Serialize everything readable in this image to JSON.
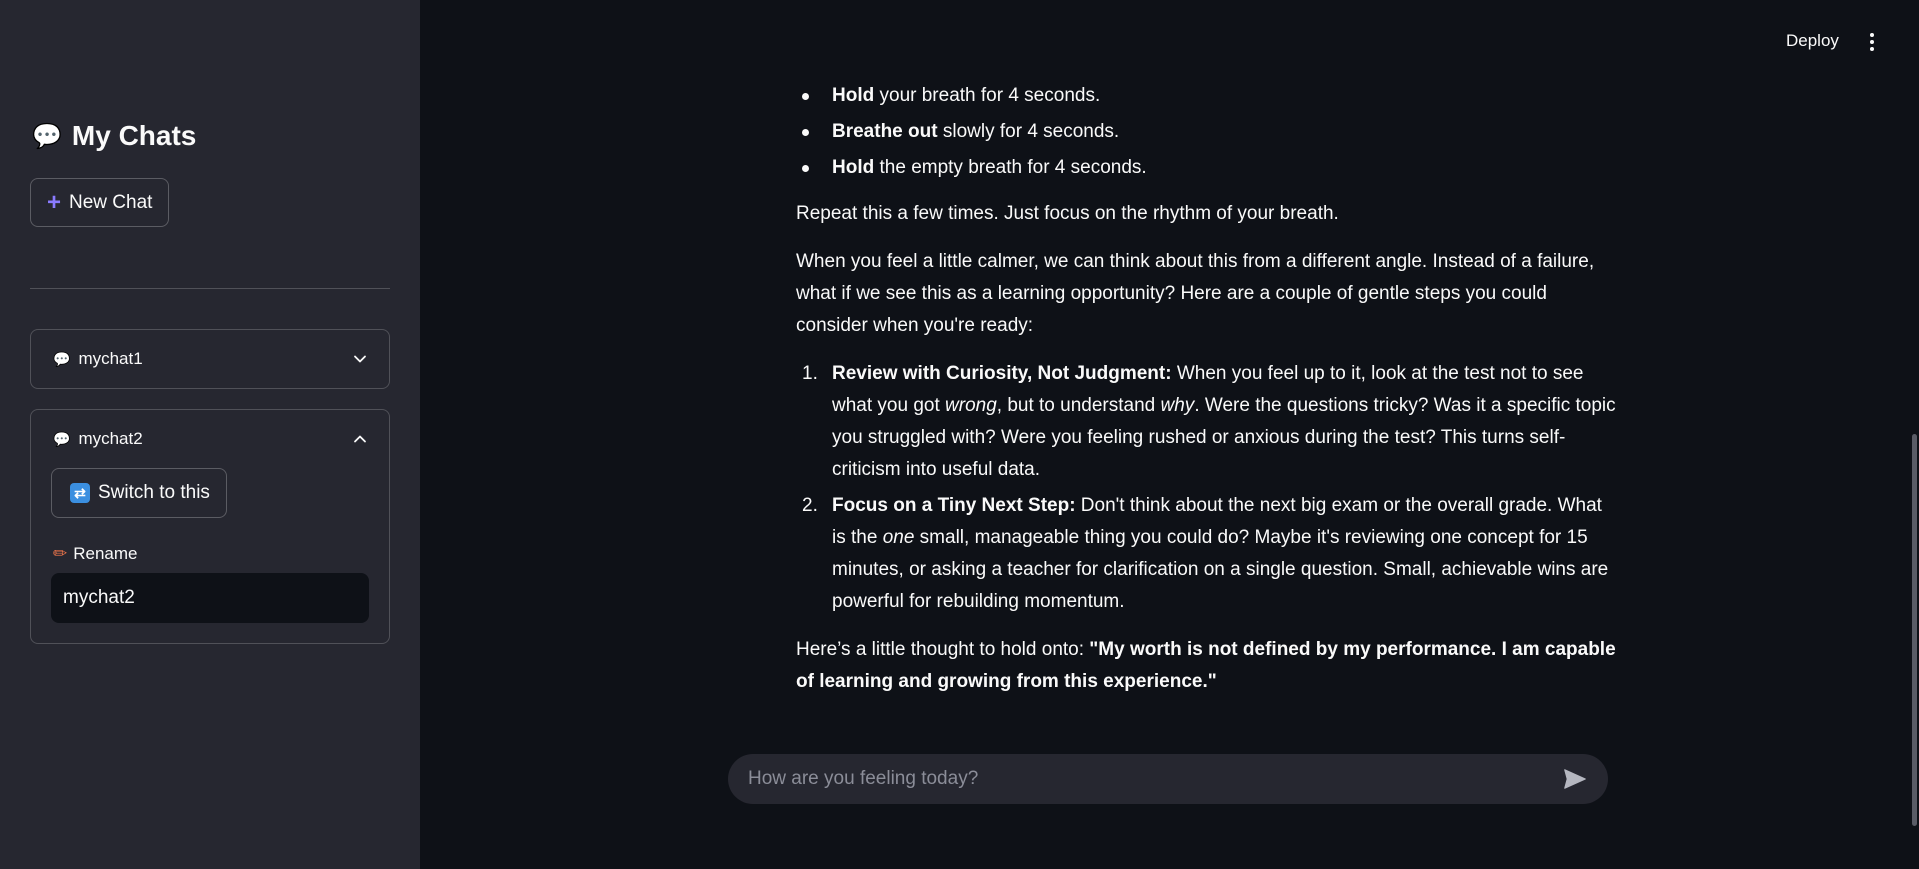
{
  "sidebar": {
    "title": "My Chats",
    "title_icon": "speech-bubble-icon",
    "new_chat_label": "New Chat",
    "chats": [
      {
        "name": "mychat1",
        "expanded": false
      },
      {
        "name": "mychat2",
        "expanded": true,
        "switch_label": "Switch to this",
        "rename_label": "Rename",
        "rename_value": "mychat2"
      }
    ]
  },
  "header": {
    "deploy_label": "Deploy"
  },
  "message": {
    "bullets": [
      {
        "bold": "Hold",
        "rest": " your breath for 4 seconds."
      },
      {
        "bold": "Breathe out",
        "rest": " slowly for 4 seconds."
      },
      {
        "bold": "Hold",
        "rest": " the empty breath for 4 seconds."
      }
    ],
    "para1": "Repeat this a few times. Just focus on the rhythm of your breath.",
    "para2": "When you feel a little calmer, we can think about this from a different angle. Instead of a failure, what if we see this as a learning opportunity? Here are a couple of gentle steps you could consider when you're ready:",
    "steps": [
      {
        "num": "1.",
        "bold": "Review with Curiosity, Not Judgment:",
        "t1": " When you feel up to it, look at the test not to see what you got ",
        "em1": "wrong",
        "t2": ", but to understand ",
        "em2": "why",
        "t3": ". Were the questions tricky? Was it a specific topic you struggled with? Were you feeling rushed or anxious during the test? This turns self-criticism into useful data."
      },
      {
        "num": "2.",
        "bold": "Focus on a Tiny Next Step:",
        "t1": " Don't think about the next big exam or the overall grade. What is the ",
        "em1": "one",
        "t2": " small, manageable thing you could do? Maybe it's reviewing one concept for 15 minutes, or asking a teacher for clarification on a single question. Small, achievable wins are powerful for rebuilding momentum."
      }
    ],
    "closing_prefix": "Here’s a little thought to hold onto: ",
    "closing_quote": "\"My worth is not defined by my performance. I am capable of learning and growing from this experience.\""
  },
  "chat_input": {
    "placeholder": "How are you feeling today?"
  }
}
